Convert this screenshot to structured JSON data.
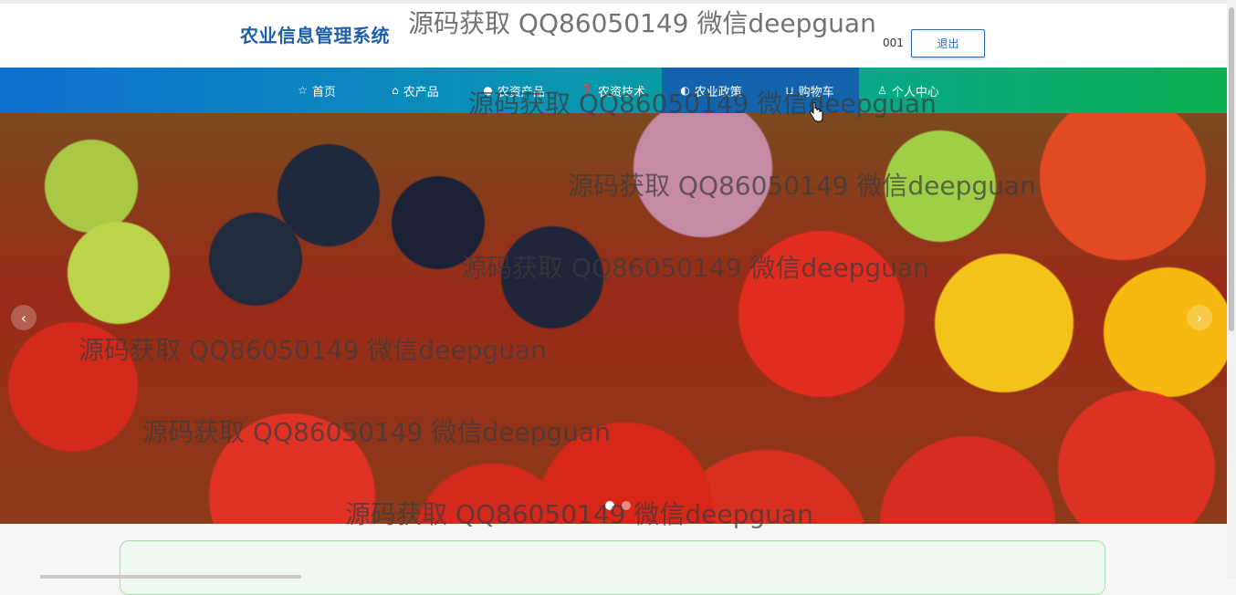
{
  "header": {
    "site_title": "农业信息管理系统",
    "username": "001",
    "logout_label": "退出"
  },
  "nav": {
    "items": [
      {
        "label": "首页",
        "icon": "star-icon"
      },
      {
        "label": "农产品",
        "icon": "bag-icon"
      },
      {
        "label": "农资产品",
        "icon": "circle-icon"
      },
      {
        "label": "农资技术",
        "icon": "help-icon"
      },
      {
        "label": "农业政策",
        "icon": "globe-icon"
      },
      {
        "label": "购物车",
        "icon": "cart-icon"
      },
      {
        "label": "个人中心",
        "icon": "user-icon"
      }
    ],
    "active": "农业政策"
  },
  "banner": {
    "prev_arrow": "‹",
    "next_arrow": "›",
    "slide_count": 2,
    "active_slide": 1
  },
  "watermark": {
    "text": "源码获取 QQ86050149 微信deepguan"
  },
  "colors": {
    "title_blue": "#1d5fa8",
    "nav_start": "#0f6fd0",
    "nav_end": "#0bb04f",
    "active_nav": "#1464ad"
  }
}
